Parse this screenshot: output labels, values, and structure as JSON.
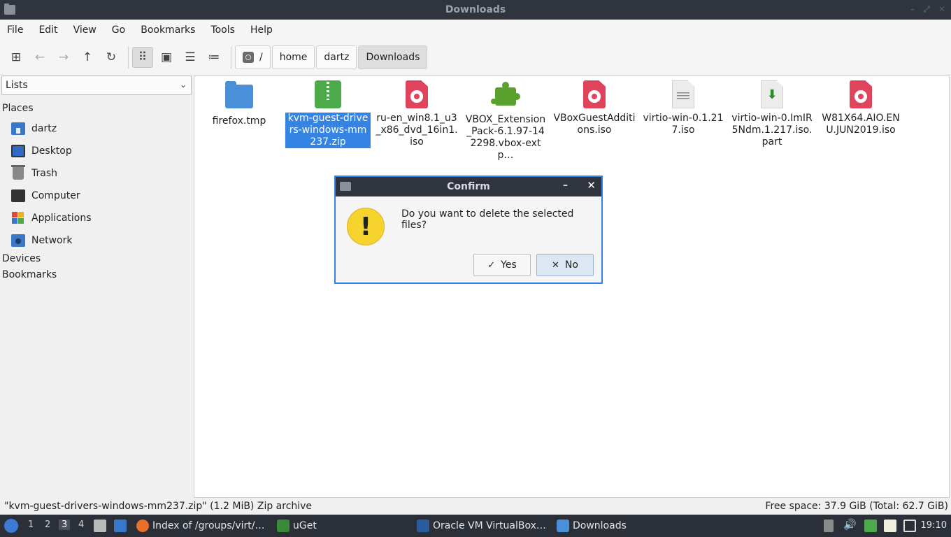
{
  "window": {
    "title": "Downloads"
  },
  "menu": [
    "File",
    "Edit",
    "View",
    "Go",
    "Bookmarks",
    "Tools",
    "Help"
  ],
  "toolbar": {
    "icons": [
      "new-window-icon",
      "back-icon",
      "forward-icon",
      "up-icon",
      "reload-icon",
      "icon-view-icon",
      "thumbnail-view-icon",
      "compact-view-icon",
      "detailed-list-icon"
    ],
    "path": [
      "/",
      "home",
      "dartz",
      "Downloads"
    ]
  },
  "sidebar": {
    "selector": "Lists",
    "places_header": "Places",
    "places": [
      "dartz",
      "Desktop",
      "Trash",
      "Computer",
      "Applications",
      "Network"
    ],
    "devices_header": "Devices",
    "bookmarks_header": "Bookmarks"
  },
  "files": [
    {
      "name": "firefox.tmp",
      "type": "folder"
    },
    {
      "name": "kvm-guest-drivers-windows-mm237.zip",
      "type": "zip",
      "selected": true
    },
    {
      "name": "ru-en_win8.1_u3_x86_dvd_16in1.iso",
      "type": "iso"
    },
    {
      "name": "VBOX_Extension_Pack-6.1.97-142298.vbox-extp…",
      "type": "extension"
    },
    {
      "name": "VBoxGuestAdditions.iso",
      "type": "iso"
    },
    {
      "name": "virtio-win-0.1.217.iso",
      "type": "text"
    },
    {
      "name": "virtio-win-0.ImIR5Ndm.1.217.iso.part",
      "type": "part"
    },
    {
      "name": "W81X64.AIO.ENU.JUN2019.iso",
      "type": "iso"
    }
  ],
  "status": {
    "selection": "\"kvm-guest-drivers-windows-mm237.zip\" (1.2 MiB) Zip archive",
    "free_space": "Free space: 37.9 GiB (Total: 62.7 GiB)"
  },
  "dialog": {
    "title": "Confirm",
    "message": "Do you want to delete the selected files?",
    "yes_label": "Yes",
    "no_label": "No",
    "minimize": "–",
    "close": "✕"
  },
  "taskbar": {
    "workspaces": [
      "1",
      "2",
      "3",
      "4"
    ],
    "active_workspace": "3",
    "tasks": [
      "Index of /groups/virt/…",
      "uGet",
      "Oracle VM VirtualBox…",
      "Downloads"
    ],
    "clock": "19:10"
  }
}
